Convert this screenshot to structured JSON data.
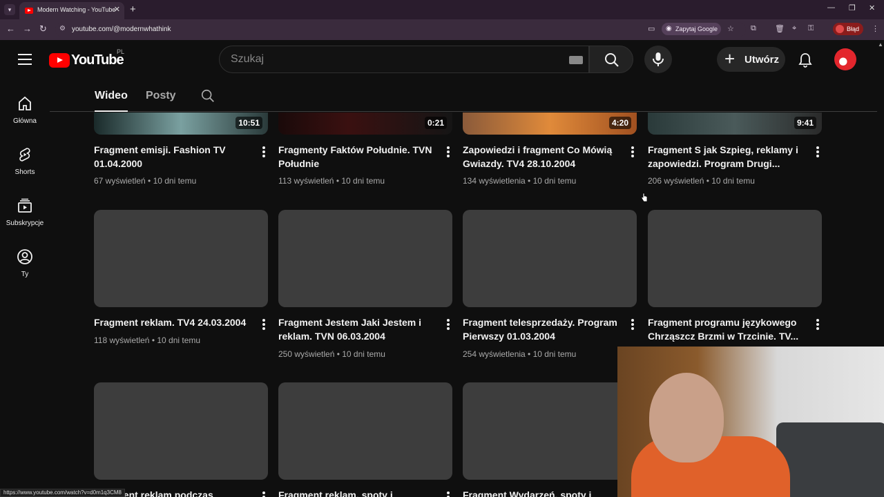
{
  "browser": {
    "tab_title": "Modern Watching - YouTube",
    "url": "youtube.com/@modernwhathink",
    "google_pill": "Zapytaj Google",
    "error_pill": "Błąd",
    "status_url": "https://www.youtube.com/watch?v=d0m1q3CM8"
  },
  "header": {
    "logo_text": "YouTube",
    "region": "PL",
    "search_placeholder": "Szukaj",
    "create_label": "Utwórz"
  },
  "sidebar": {
    "items": [
      {
        "label": "Główna",
        "icon": "home-icon"
      },
      {
        "label": "Shorts",
        "icon": "shorts-icon"
      },
      {
        "label": "Subskrypcje",
        "icon": "subscriptions-icon"
      },
      {
        "label": "Ty",
        "icon": "you-icon"
      }
    ]
  },
  "channel_tabs": {
    "active": "Wideo",
    "other": "Posty"
  },
  "videos": {
    "row1": [
      {
        "title": "Fragment emisji. Fashion TV 01.04.2000",
        "duration": "10:51",
        "meta": "67 wyświetleń • 10 dni temu"
      },
      {
        "title": "Fragmenty Faktów Południe. TVN Południe",
        "duration": "0:21",
        "meta": "113 wyświetleń • 10 dni temu"
      },
      {
        "title": "Zapowiedzi i fragment Co Mówią Gwiazdy. TV4 28.10.2004",
        "duration": "4:20",
        "meta": "134 wyświetlenia • 10 dni temu"
      },
      {
        "title": "Fragment S jak Szpieg, reklamy i zapowiedzi. Program Drugi...",
        "duration": "9:41",
        "meta": "206 wyświetleń • 10 dni temu"
      }
    ],
    "row2": [
      {
        "title": "Fragment reklam. TV4 24.03.2004",
        "meta": "118 wyświetleń • 10 dni temu"
      },
      {
        "title": "Fragment Jestem Jaki Jestem i reklam. TVN 06.03.2004",
        "meta": "250 wyświetleń • 10 dni temu"
      },
      {
        "title": "Fragment telesprzedaży. Program Pierwszy 01.03.2004",
        "meta": "254 wyświetlenia • 10 dni temu"
      },
      {
        "title": "Fragment programu językowego Chrząszcz Brzmi w Trzcinie. TV...",
        "meta": ""
      }
    ],
    "row3": [
      {
        "title": "Fragment reklam podczas przerwy w"
      },
      {
        "title": "Fragment reklam, spoty i"
      },
      {
        "title": "Fragment Wydarzeń, spoty i"
      }
    ]
  },
  "colors": {
    "background": "#0f0f0f",
    "brand_red": "#ff0000",
    "browser_frame": "#3a2b3d"
  }
}
